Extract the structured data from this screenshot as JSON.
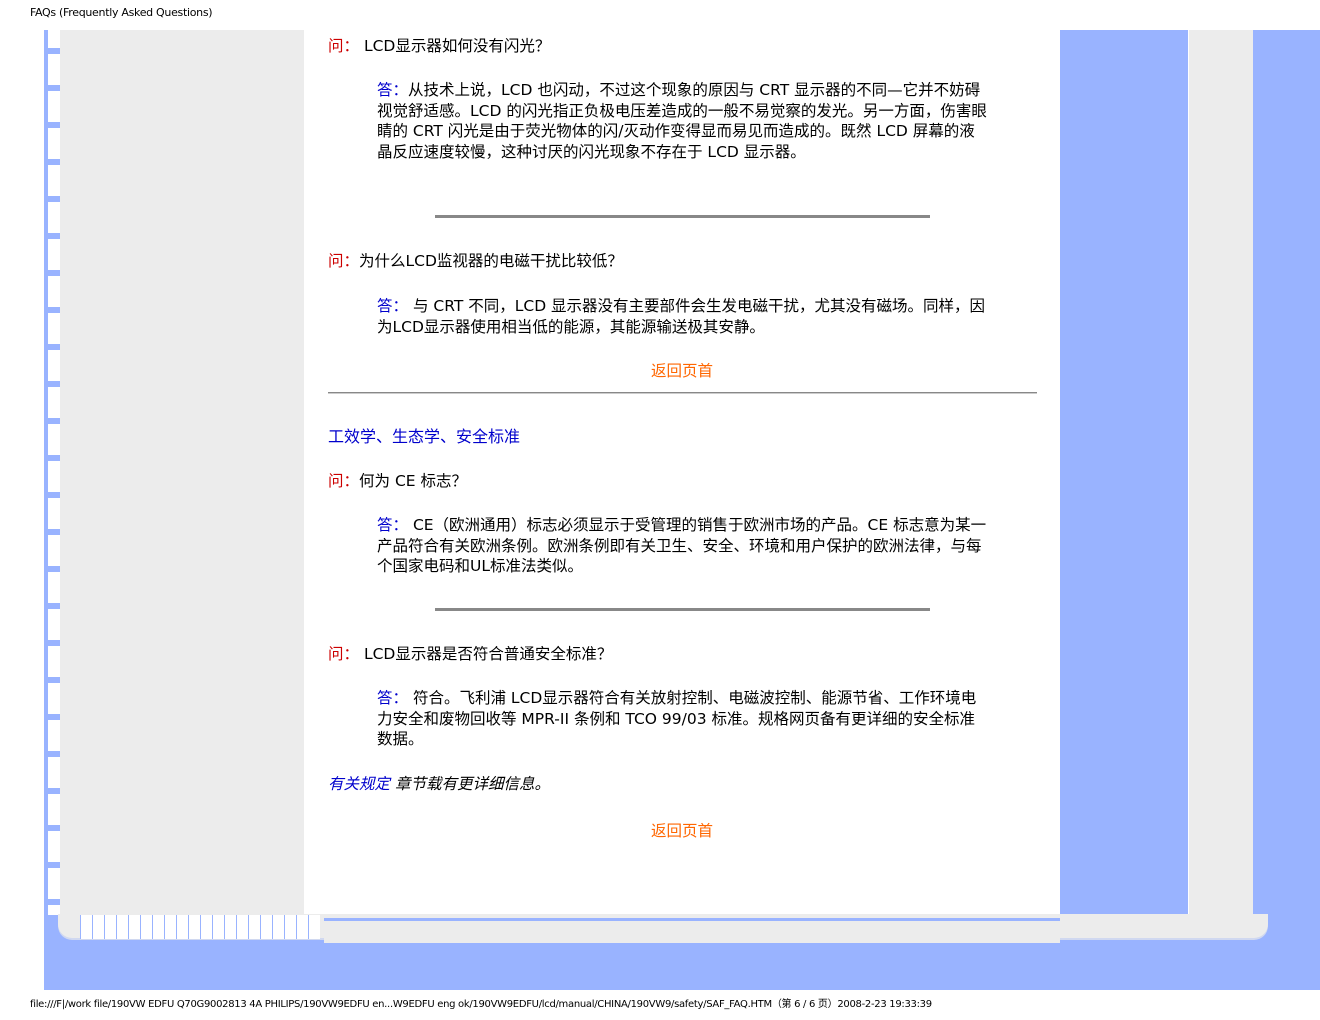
{
  "window": {
    "title": "FAQs (Frequently Asked Questions)"
  },
  "faq": [
    {
      "q_prefix": "问：",
      "question": " LCD显示器如何没有闪光？",
      "a_prefix": "答：",
      "answer": "从技术上说，LCD 也闪动，不过这个现象的原因与  CRT  显示器的不同—它并不妨碍视觉舒适感。LCD 的闪光指正负极电压差造成的一般不易觉察的发光。另一方面，伤害眼睛的  CRT  闪光是由于荧光物体的闪/灭动作变得显而易见而造成的。既然  LCD  屏幕的液晶反应速度较慢，这种讨厌的闪光现象不存在于  LCD 显示器。"
    },
    {
      "q_prefix": "问：",
      "question": "为什么LCD监视器的电磁干扰比较低？",
      "a_prefix": "答：",
      "answer": " 与  CRT  不同，LCD 显示器没有主要部件会生发电磁干扰，尤其没有磁场。同样，因为LCD显示器使用相当低的能源，其能源输送极其安静。"
    }
  ],
  "back_to_top_1": "返回页首",
  "section_title": "工效学、生态学、安全标准",
  "faq2": [
    {
      "q_prefix": "问：",
      "question": "何为  CE  标志？",
      "a_prefix": "答：",
      "answer": " CE（欧洲通用）标志必须显示于受管理的销售于欧洲市场的产品。CE  标志意为某一产品符合有关欧洲条例。欧洲条例即有关卫生、安全、环境和用户保护的欧洲法律，与每个国家电码和UL标准法类似。"
    },
    {
      "q_prefix": "问：",
      "question": " LCD显示器是否符合普通安全标准？",
      "a_prefix": "答：",
      "answer": " 符合。飞利浦  LCD显示器符合有关放射控制、电磁波控制、能源节省、工作环境电力安全和废物回收等  MPR-II  条例和  TCO 99/03  标准。规格网页备有更详细的安全标准数据。"
    }
  ],
  "ref_link": "有关规定",
  "ref_text": " 章节载有更详细信息。",
  "back_to_top_2": "返回页首",
  "footer": "file:///F|/work file/190VW EDFU Q70G9002813 4A PHILIPS/190VW9EDFU en...W9EDFU eng ok/190VW9EDFU/lcd/manual/CHINA/190VW9/safety/SAF_FAQ.HTM（第 6 / 6 页）2008-2-23 19:33:39"
}
